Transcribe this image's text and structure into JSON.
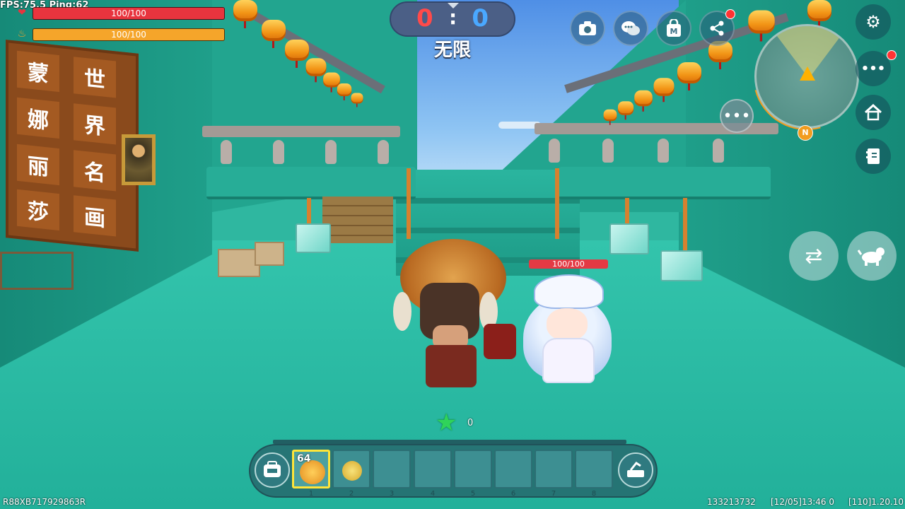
{
  "hud": {
    "fps_ping": "FPS:75.5  Ping:62",
    "health": {
      "label": "100/100",
      "value": 100,
      "max": 100,
      "color": "#e8343e",
      "icon": "heart-icon"
    },
    "hunger": {
      "label": "100/100",
      "value": 100,
      "max": 100,
      "color": "#f5a52a",
      "icon": "drumstick-icon"
    }
  },
  "score": {
    "red": "0",
    "separator": ":",
    "blue": "0",
    "mode": "无限"
  },
  "top_buttons": [
    {
      "name": "camera-button",
      "icon": "camera-icon"
    },
    {
      "name": "chat-button",
      "icon": "speech-bubbles-icon"
    },
    {
      "name": "shop-button",
      "icon": "shopping-bag-icon"
    },
    {
      "name": "share-button",
      "icon": "share-icon"
    }
  ],
  "side_buttons": [
    {
      "name": "settings-button",
      "icon": "gear-icon"
    },
    {
      "name": "more-button",
      "icon": "more-dots-icon"
    },
    {
      "name": "home-button",
      "icon": "home-icon"
    },
    {
      "name": "notebook-button",
      "icon": "notebook-icon"
    }
  ],
  "minimap": {
    "compass_north": "N"
  },
  "calligraphy": [
    "蒙",
    "世",
    "娜",
    "界",
    "丽",
    "名",
    "莎",
    "画"
  ],
  "npc": {
    "health_label": "100/100"
  },
  "stars": {
    "count": "0"
  },
  "hotbar": {
    "slots": [
      {
        "number": "1",
        "count": "64",
        "item": "roast-chicken",
        "selected": true
      },
      {
        "number": "2",
        "count": "",
        "item": "star-cart"
      },
      {
        "number": "3",
        "count": ""
      },
      {
        "number": "4",
        "count": ""
      },
      {
        "number": "5",
        "count": ""
      },
      {
        "number": "6",
        "count": ""
      },
      {
        "number": "7",
        "count": ""
      },
      {
        "number": "8",
        "count": ""
      }
    ]
  },
  "footer": {
    "left_id": "R88XB717929863R",
    "uid": "133213732",
    "timestamp": "[12/05]13:46 0",
    "version": "[110]1.20.10"
  }
}
